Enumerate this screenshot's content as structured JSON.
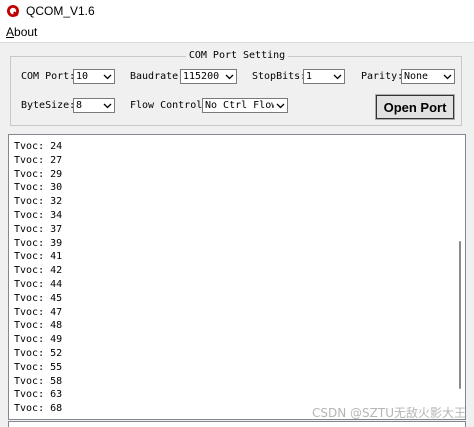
{
  "window": {
    "title": "QCOM_V1.6",
    "icon": "qcom-app-icon"
  },
  "menu": {
    "about": "About",
    "about_mnemonic": "A",
    "about_rest": "bout"
  },
  "settings": {
    "group_title": "COM Port Setting",
    "com_port_label": "COM Port:",
    "com_port_value": "10",
    "baudrate_label": "Baudrate:",
    "baudrate_value": "115200",
    "stopbits_label": "StopBits:",
    "stopbits_value": "1",
    "parity_label": "Parity:",
    "parity_value": "None",
    "bytesize_label": "ByteSize:",
    "bytesize_value": "8",
    "flow_label": "Flow Control:",
    "flow_value": "No Ctrl Flow",
    "open_button": "Open Port"
  },
  "output": {
    "lines": [
      "Tvoc: 24",
      "Tvoc: 27",
      "Tvoc: 29",
      "Tvoc: 30",
      "Tvoc: 32",
      "Tvoc: 34",
      "Tvoc: 37",
      "Tvoc: 39",
      "Tvoc: 41",
      "Tvoc: 42",
      "Tvoc: 44",
      "Tvoc: 45",
      "Tvoc: 47",
      "Tvoc: 48",
      "Tvoc: 49",
      "Tvoc: 52",
      "Tvoc: 55",
      "Tvoc: 58",
      "Tvoc: 63",
      "Tvoc: 68"
    ]
  },
  "watermark": "CSDN @SZTU无敌火影大王"
}
